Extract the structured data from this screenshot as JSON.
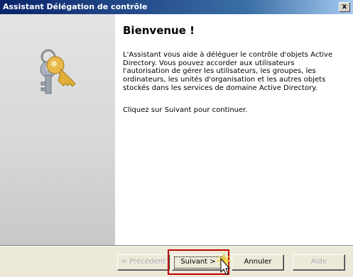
{
  "window": {
    "title": "Assistant Délégation de contrôle",
    "close_label": "x"
  },
  "left_panel": {
    "icon": "keys-icon"
  },
  "content": {
    "heading": "Bienvenue !",
    "description": "L'Assistant vous aide à déléguer le contrôle d'objets Active Directory. Vous pouvez accorder aux utilisateurs l'autorisation de gérer les utilisateurs, les groupes, les ordinateurs, les unités d'organisation et les autres objets stockés dans les services de domaine Active Directory.",
    "continue_text": "Cliquez sur Suivant pour continuer."
  },
  "buttons": {
    "previous": "< Précédent",
    "next": "Suivant >",
    "cancel": "Annuler",
    "help": "Aide"
  },
  "colors": {
    "titlebar_start": "#0A246A",
    "titlebar_end": "#A6CAF0",
    "highlight": "#C00000",
    "key_gold": "#E8B84A",
    "key_silver": "#A9B2BC"
  }
}
